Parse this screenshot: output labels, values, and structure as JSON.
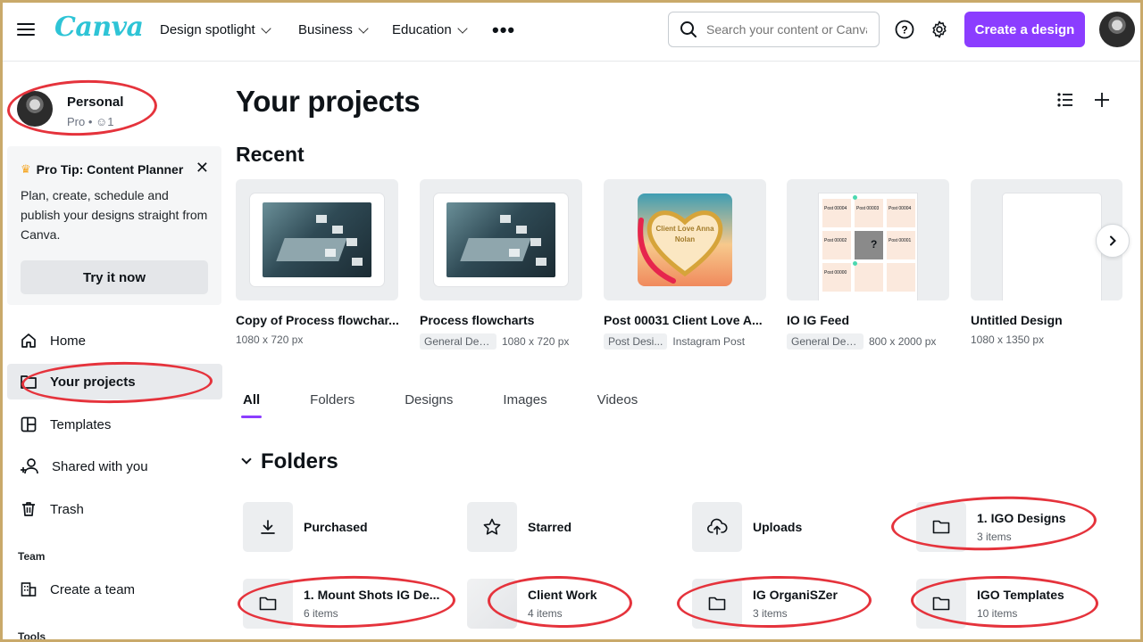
{
  "header": {
    "logo": "Canva",
    "nav": [
      "Design spotlight",
      "Business",
      "Education"
    ],
    "search_placeholder": "Search your content or Canva",
    "create_label": "Create a design"
  },
  "sidebar": {
    "account_name": "Personal",
    "account_sub": "Pro • ☺1",
    "tip_title": "Pro Tip: Content Planner",
    "tip_body": "Plan, create, schedule and publish your designs straight from Canva.",
    "tip_button": "Try it now",
    "items": [
      "Home",
      "Your projects",
      "Templates",
      "Shared with you",
      "Trash"
    ],
    "team_label": "Team",
    "create_team": "Create a team",
    "tools_label": "Tools"
  },
  "main": {
    "title": "Your projects",
    "recent_label": "Recent",
    "recent": [
      {
        "title": "Copy of Process flowchar...",
        "chip": "",
        "meta": "1080 x 720 px"
      },
      {
        "title": "Process flowcharts",
        "chip": "General Desi...",
        "meta": "1080 x 720 px"
      },
      {
        "title": "Post 00031 Client Love A...",
        "chip": "Post Desi...",
        "meta": "Instagram Post"
      },
      {
        "title": "IO IG Feed",
        "chip": "General Desi...",
        "meta": "800 x 2000 px"
      },
      {
        "title": "Untitled Design",
        "chip": "",
        "meta": "1080 x 1350 px"
      }
    ],
    "heart_text": "Client Love Anna Nolan",
    "feed_post_labels": [
      "Post 00004",
      "Post 00003",
      "Post 00004",
      "Post 00002",
      "Post 00001",
      "Post 00000"
    ],
    "tabs": [
      "All",
      "Folders",
      "Designs",
      "Images",
      "Videos"
    ],
    "folders_label": "Folders",
    "folders": [
      {
        "name": "Purchased",
        "count": ""
      },
      {
        "name": "Starred",
        "count": ""
      },
      {
        "name": "Uploads",
        "count": ""
      },
      {
        "name": "1. IGO Designs",
        "count": "3 items"
      },
      {
        "name": "1. Mount Shots IG De...",
        "count": "6 items"
      },
      {
        "name": "Client Work",
        "count": "4 items"
      },
      {
        "name": "IG OrganiSZer",
        "count": "3 items"
      },
      {
        "name": "IGO Templates",
        "count": "10 items"
      }
    ]
  },
  "colors": {
    "accent": "#8b3dff",
    "logo": "#2ec4d6",
    "annotation": "#e5333c"
  }
}
